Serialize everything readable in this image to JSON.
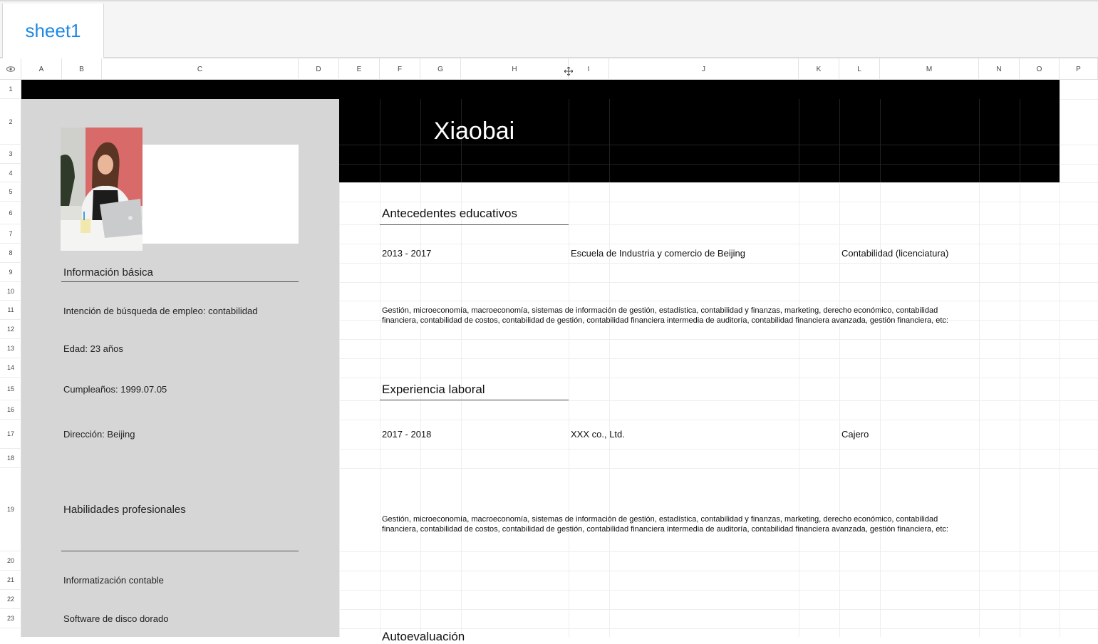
{
  "sheet_tab": "sheet1",
  "columns": [
    "A",
    "B",
    "C",
    "D",
    "E",
    "F",
    "G",
    "H",
    "I",
    "J",
    "K",
    "L",
    "M",
    "N",
    "O",
    "P"
  ],
  "rows": [
    "1",
    "2",
    "3",
    "4",
    "5",
    "6",
    "7",
    "8",
    "9",
    "10",
    "11",
    "12",
    "13",
    "14",
    "15",
    "16",
    "17",
    "18",
    "19",
    "20",
    "21",
    "22",
    "23"
  ],
  "icons": {
    "corner": "eye-icon",
    "cursor": "move-cursor-icon"
  },
  "resume": {
    "name": "Xiaobai",
    "basic_info_title": "Información básica",
    "job_intention": "Intención de búsqueda de empleo: contabilidad",
    "age": "Edad: 23 años",
    "birthday": "Cumpleaños: 1999.07.05",
    "address": "Dirección: Beijing",
    "skills_title": "Habilidades profesionales",
    "skills": [
      "Informatización contable",
      "Software de disco dorado"
    ],
    "education_title": "Antecedentes educativos",
    "education": {
      "period": "2013 - 2017",
      "school": "Escuela de Industria y comercio de Beijing",
      "degree": "Contabilidad (licenciatura)",
      "description": "Gestión, microeconomía, macroeconomía, sistemas de información de gestión, estadística, contabilidad y finanzas, marketing, derecho económico, contabilidad financiera, contabilidad de costos, contabilidad de gestión, contabilidad financiera intermedia de auditoría, contabilidad financiera avanzada, gestión financiera, etc:"
    },
    "experience_title": "Experiencia laboral",
    "experience": {
      "period": "2017 - 2018",
      "company": "XXX co., Ltd.",
      "position": "Cajero",
      "description": "Gestión, microeconomía, macroeconomía, sistemas de información de gestión, estadística, contabilidad y finanzas, marketing, derecho económico, contabilidad financiera, contabilidad de costos, contabilidad de gestión, contabilidad financiera intermedia de auditoría, contabilidad financiera avanzada, gestión financiera, etc:"
    },
    "next_section_partial": "Autoevaluación"
  },
  "colors": {
    "tab_text": "#1e88e5",
    "header_black": "#000000",
    "sidebar_gray": "#d6d6d6"
  }
}
